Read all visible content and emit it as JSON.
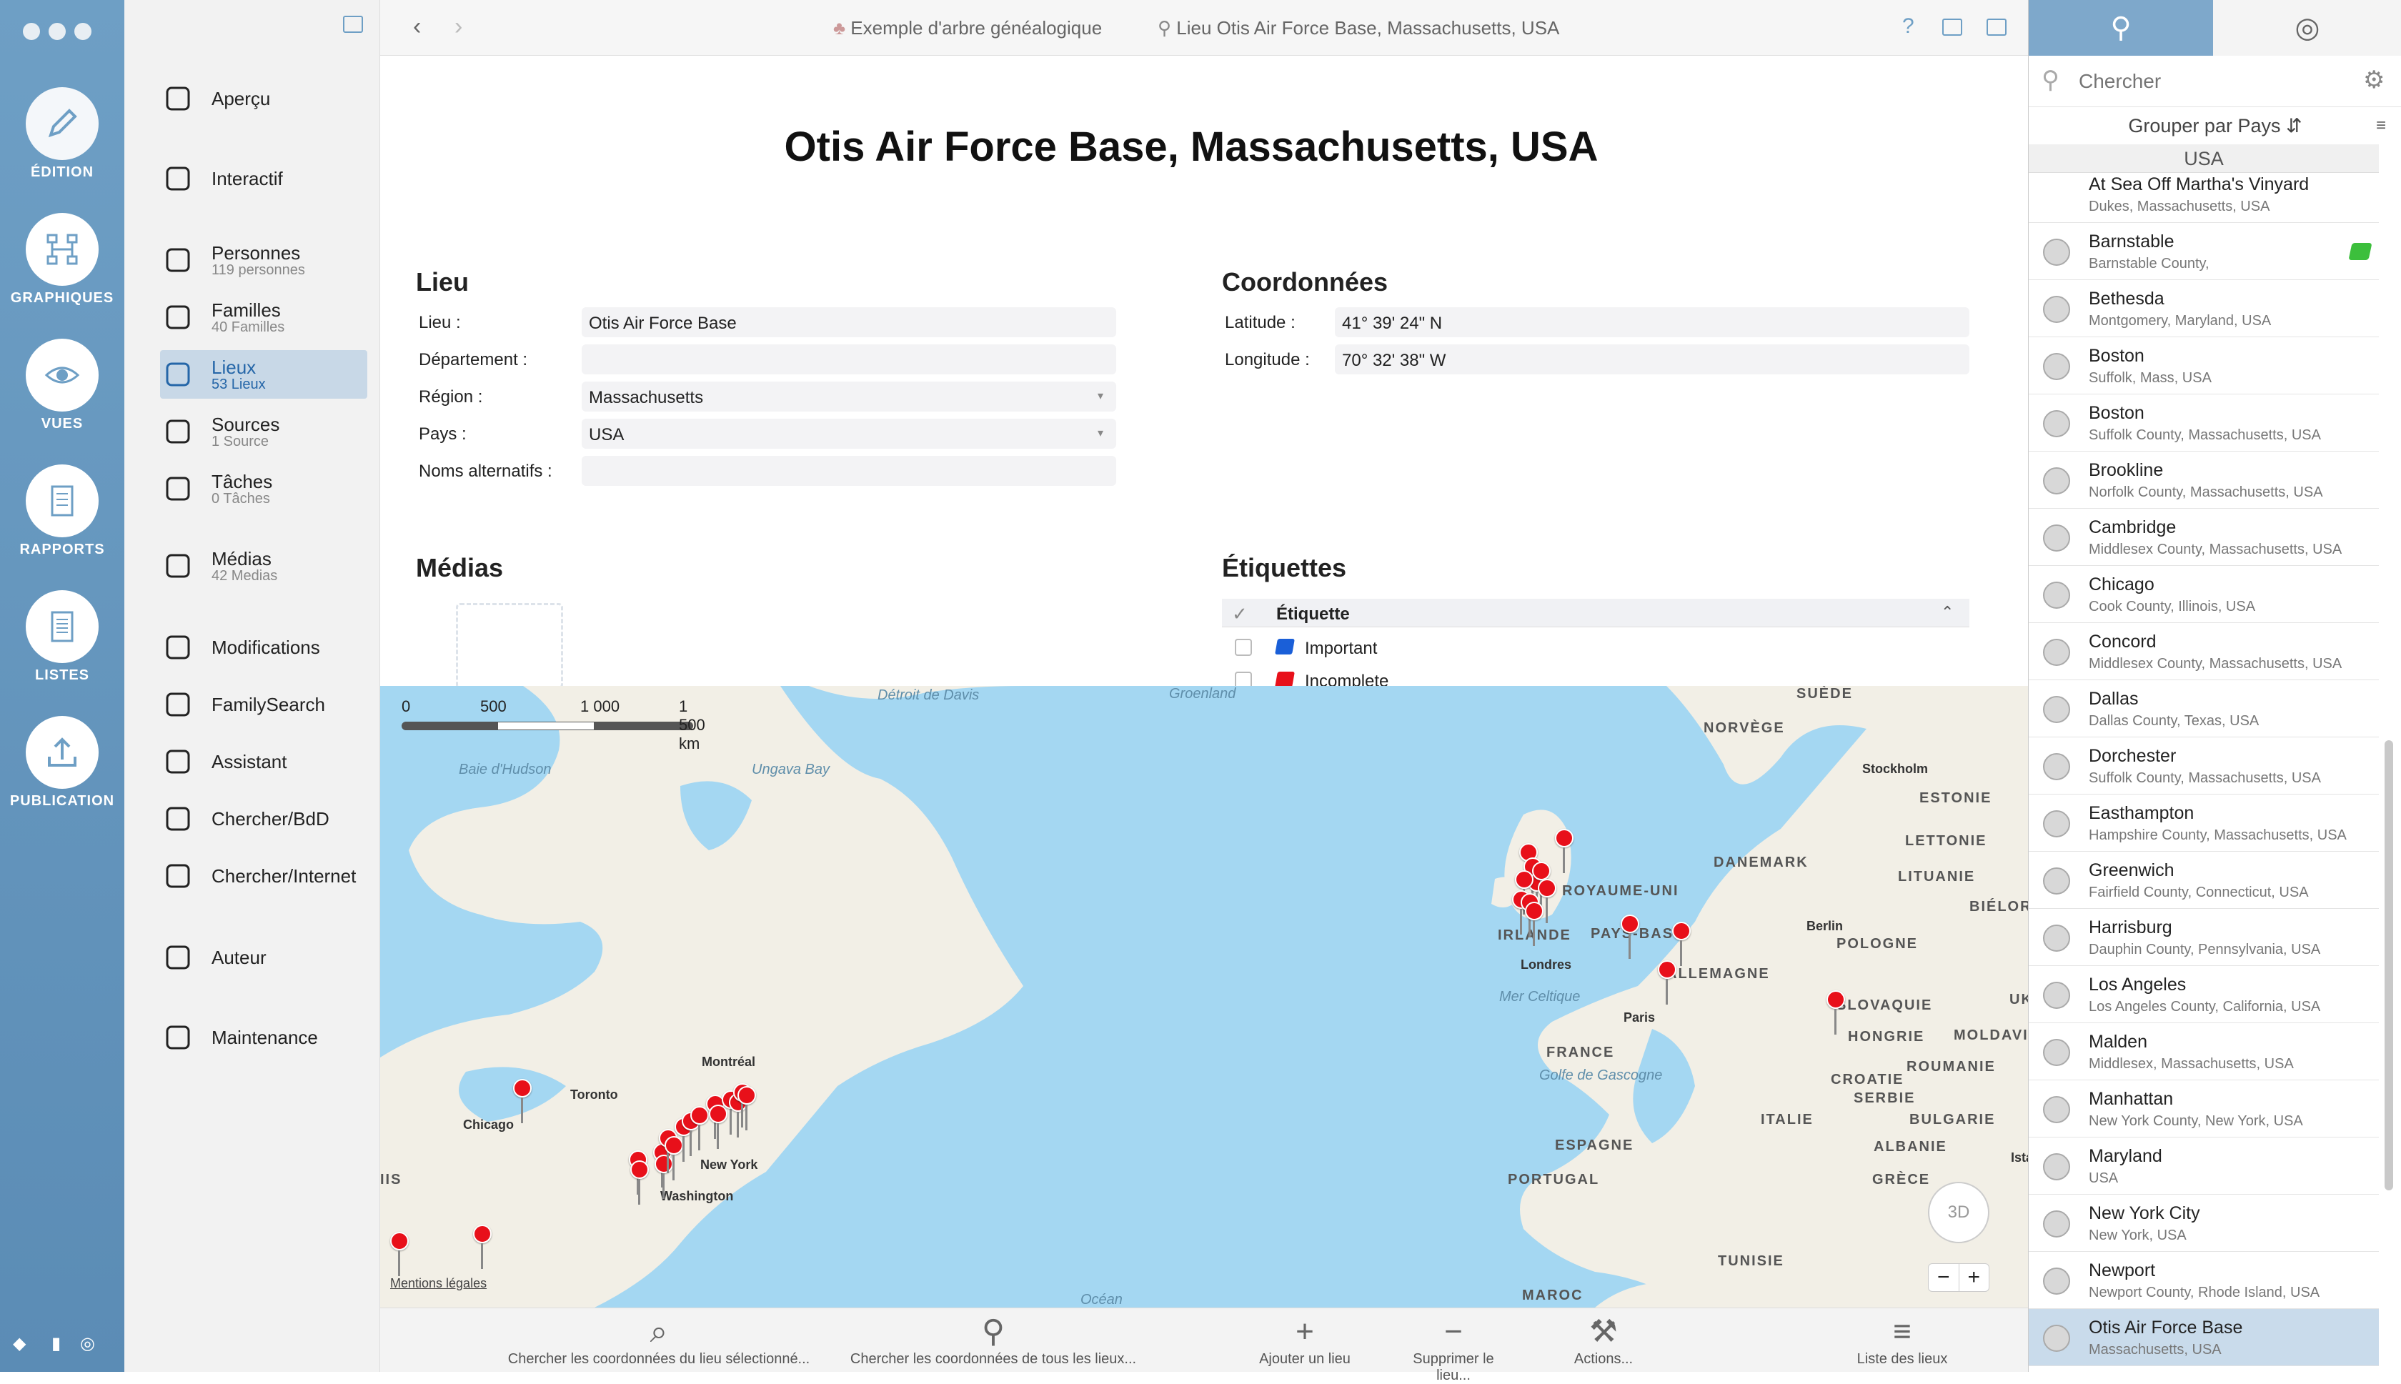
{
  "window": {
    "breadcrumb_tree": "Exemple d'arbre généalogique",
    "breadcrumb_place": "Lieu Otis Air Force Base, Massachusetts, USA"
  },
  "rail": {
    "items": [
      {
        "label": "ÉDITION",
        "icon": "pencil-icon"
      },
      {
        "label": "GRAPHIQUES",
        "icon": "chart-icon"
      },
      {
        "label": "VUES",
        "icon": "eye-icon"
      },
      {
        "label": "RAPPORTS",
        "icon": "report-icon"
      },
      {
        "label": "LISTES",
        "icon": "list-icon"
      },
      {
        "label": "PUBLICATION",
        "icon": "publish-icon"
      }
    ]
  },
  "sidebar": {
    "items": [
      {
        "label": "Aperçu",
        "sub": "",
        "icon": "grid-icon"
      },
      {
        "label": "Interactif",
        "sub": "",
        "icon": "tree-icon"
      },
      {
        "label": "Personnes",
        "sub": "119 personnes",
        "icon": "person-icon"
      },
      {
        "label": "Familles",
        "sub": "40 Familles",
        "icon": "rings-icon"
      },
      {
        "label": "Lieux",
        "sub": "53 Lieux",
        "icon": "pin-icon"
      },
      {
        "label": "Sources",
        "sub": "1 Source",
        "icon": "documents-icon"
      },
      {
        "label": "Tâches",
        "sub": "0 Tâches",
        "icon": "check-icon"
      },
      {
        "label": "Médias",
        "sub": "42 Medias",
        "icon": "mountain-icon"
      },
      {
        "label": "Modifications",
        "sub": "",
        "icon": "list-lines-icon"
      },
      {
        "label": "FamilySearch",
        "sub": "",
        "icon": "familysearch-icon"
      },
      {
        "label": "Assistant",
        "sub": "",
        "icon": "wand-icon"
      },
      {
        "label": "Chercher/BdD",
        "sub": "",
        "icon": "magnifier-icon"
      },
      {
        "label": "Chercher/Internet",
        "sub": "",
        "icon": "globe-search-icon"
      },
      {
        "label": "Auteur",
        "sub": "",
        "icon": "pen-nib-icon"
      },
      {
        "label": "Maintenance",
        "sub": "",
        "icon": "maintenance-icon"
      }
    ]
  },
  "main": {
    "title": "Otis Air Force Base, Massachusetts, USA",
    "lieu_section": "Lieu",
    "fields": [
      {
        "label": "Lieu :",
        "value": "Otis Air Force Base"
      },
      {
        "label": "Département :",
        "value": ""
      },
      {
        "label": "Région :",
        "value": "Massachusetts"
      },
      {
        "label": "Pays :",
        "value": "USA"
      },
      {
        "label": "Noms alternatifs :",
        "value": ""
      }
    ],
    "coord_section": "Coordonnées",
    "coords": [
      {
        "label": "Latitude :",
        "value": "41° 39' 24\" N"
      },
      {
        "label": "Longitude :",
        "value": "70° 32' 38\" W"
      }
    ],
    "media_section": "Médias",
    "tags_section": "Étiquettes",
    "tags_header": "Étiquette",
    "tags": [
      {
        "label": "Important",
        "color": "#1a5fd8"
      },
      {
        "label": "Incomplete",
        "color": "#e8101a"
      }
    ]
  },
  "map": {
    "scale": [
      "0",
      "500",
      "1 000",
      "1 500 km"
    ],
    "labels": [
      "Détroit de Davis",
      "Groenland",
      "Baie d'Hudson",
      "Ungava Bay",
      "SUÈDE",
      "NORVÈGE",
      "Stockholm",
      "ESTONIE",
      "LETTONIE",
      "DANEMARK",
      "LITUANIE",
      "BIÉLORUSS",
      "ROYAUME-UNI",
      "IRLANDE",
      "Londres",
      "PAYS-BAS",
      "Berlin",
      "POLOGNE",
      "ALLEMAGNE",
      "UKRA",
      "Mer Celtique",
      "Paris",
      "SLOVAQUIE",
      "HONGRIE",
      "MOLDAVI",
      "FRANCE",
      "ROUMANIE",
      "Golfe de Gascogne",
      "CROATIE",
      "SERBIE",
      "BULGARIE",
      "ITALIE",
      "ALBANIE",
      "ESPAGNE",
      "PORTUGAL",
      "GRÈCE",
      "Ista",
      "TUNISIE",
      "MAROC",
      "Océan",
      "Montréal",
      "Toronto",
      "Chicago",
      "New York",
      "Washington",
      "IIS"
    ],
    "legal": "Mentions légales",
    "btn_3d": "3D",
    "zoom_out": "−",
    "zoom_in": "+"
  },
  "bottom": {
    "buttons": [
      {
        "label": "Chercher les coordonnées du lieu sélectionné...",
        "icon": "magnifier-icon"
      },
      {
        "label": "Chercher les coordonnées de tous les lieux...",
        "icon": "pin-icon"
      },
      {
        "label": "Ajouter un lieu",
        "icon": "plus-icon"
      },
      {
        "label": "Supprimer le lieu...",
        "icon": "minus-icon"
      },
      {
        "label": "Actions...",
        "icon": "hammer-icon"
      },
      {
        "label": "Liste des lieux",
        "icon": "list-icon"
      }
    ]
  },
  "rightpanel": {
    "search_placeholder": "Chercher",
    "group_by": "Grouper par Pays",
    "group_header": "USA",
    "places": [
      {
        "name": "At Sea Off Martha's Vinyard",
        "addr": "Dukes, Massachusetts, USA"
      },
      {
        "name": "Barnstable",
        "addr": "Barnstable County,"
      },
      {
        "name": "Bethesda",
        "addr": "Montgomery, Maryland, USA"
      },
      {
        "name": "Boston",
        "addr": "Suffolk, Mass, USA"
      },
      {
        "name": "Boston",
        "addr": "Suffolk County, Massachusetts, USA"
      },
      {
        "name": "Brookline",
        "addr": "Norfolk County, Massachusetts, USA"
      },
      {
        "name": "Cambridge",
        "addr": "Middlesex County, Massachusetts, USA"
      },
      {
        "name": "Chicago",
        "addr": "Cook County, Illinois, USA"
      },
      {
        "name": "Concord",
        "addr": "Middlesex County, Massachusetts, USA"
      },
      {
        "name": "Dallas",
        "addr": "Dallas County, Texas, USA"
      },
      {
        "name": "Dorchester",
        "addr": "Suffolk County, Massachusetts, USA"
      },
      {
        "name": "Easthampton",
        "addr": "Hampshire County, Massachusetts, USA"
      },
      {
        "name": "Greenwich",
        "addr": "Fairfield County, Connecticut, USA"
      },
      {
        "name": "Harrisburg",
        "addr": "Dauphin County, Pennsylvania, USA"
      },
      {
        "name": "Los Angeles",
        "addr": "Los Angeles County, California, USA"
      },
      {
        "name": "Malden",
        "addr": "Middlesex, Massachusetts, USA"
      },
      {
        "name": "Manhattan",
        "addr": "New York County, New York, USA"
      },
      {
        "name": "Maryland",
        "addr": "USA"
      },
      {
        "name": "New York City",
        "addr": "New York, USA"
      },
      {
        "name": "Newport",
        "addr": "Newport County, Rhode Island, USA"
      },
      {
        "name": "Otis Air Force Base",
        "addr": "Massachusetts, USA"
      }
    ]
  },
  "colors": {
    "rail": "#6e9fc5",
    "selected": "#c9dbeb",
    "pin": "#e8101a",
    "ocean": "#a4d7f2",
    "land": "#f2efe6"
  }
}
